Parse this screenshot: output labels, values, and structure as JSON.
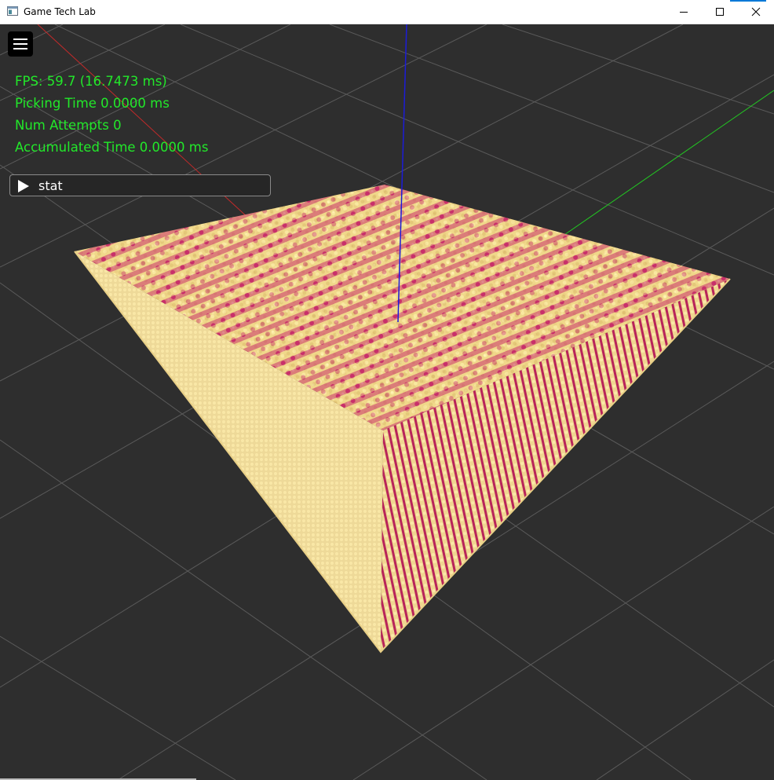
{
  "window": {
    "title": "Game Tech Lab",
    "icon": "app-window-icon",
    "controls": [
      "minimize-icon",
      "maximize-icon",
      "close-icon"
    ],
    "accent_color": "#0078d7"
  },
  "viewport": {
    "background_color": "#2e2e2e",
    "grid_color": "#5a5a5a",
    "axis_colors": {
      "x": "#c42a2a",
      "y": "#1c1cd8",
      "z": "#22c822"
    },
    "cube_colors": {
      "cream": "#f2dc8c",
      "pink": "#c8306a"
    }
  },
  "hud": {
    "menu_icon": "hamburger-menu-icon",
    "stats_color": "#22e82a",
    "fps": "FPS: 59.7 (16.7473 ms)",
    "picking_time": "Picking Time 0.0000 ms",
    "num_attempts": "Num Attempts 0",
    "accumulated_time": "Accumulated Time 0.0000 ms",
    "stat_panel": {
      "icon": "play-icon",
      "label": "stat"
    }
  }
}
